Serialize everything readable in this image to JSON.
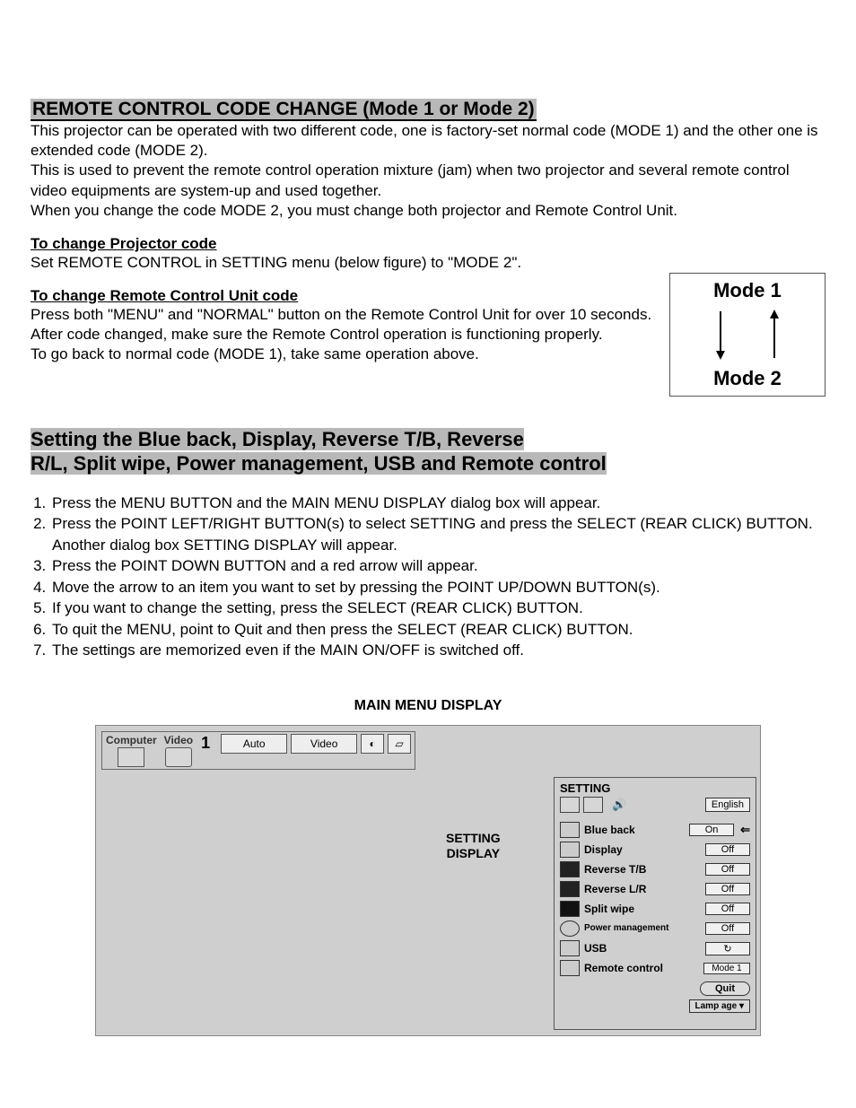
{
  "section1": {
    "title": "REMOTE CONTROL CODE CHANGE (Mode 1 or Mode 2)",
    "p1": "This projector can be operated with two different code, one is factory-set normal code (MODE 1) and the other one is extended code (MODE 2).",
    "p2": "This is used to prevent the remote control operation mixture (jam) when two projector and several remote control video equipments are system-up and used together.",
    "p3": "When you change the code MODE 2, you must change both projector and Remote Control Unit.",
    "sub1_title": "To change Projector code",
    "sub1_body": "Set REMOTE CONTROL in SETTING menu (below figure) to \"MODE 2\".",
    "sub2_title": "To change Remote Control Unit code",
    "sub2_body1": "Press both \"MENU\" and \"NORMAL\" button on the Remote Control Unit for over 10 seconds.",
    "sub2_body2": "After code changed, make sure the Remote Control operation is functioning properly.",
    "sub2_body3": "To go back to normal code (MODE 1), take same operation above."
  },
  "mode_box": {
    "top": "Mode 1",
    "bottom": "Mode 2"
  },
  "section2": {
    "title_l1": "Setting the Blue back, Display, Reverse T/B, Reverse",
    "title_l2": "R/L, Split wipe, Power management, USB and Remote control",
    "steps": [
      "Press the MENU BUTTON and the MAIN MENU DISPLAY dialog box will appear.",
      "Press the POINT LEFT/RIGHT BUTTON(s) to select SETTING and press the SELECT (REAR CLICK) BUTTON. Another dialog box SETTING DISPLAY will appear.",
      "Press the POINT DOWN BUTTON and a red arrow will appear.",
      "Move the arrow to an item you want to set by pressing the POINT UP/DOWN BUTTON(s).",
      "If you want to change the setting, press the SELECT (REAR CLICK) BUTTON.",
      "To quit the MENU, point to Quit and then press the SELECT (REAR CLICK) BUTTON.",
      "The settings are memorized even if the MAIN ON/OFF is switched off."
    ]
  },
  "menu": {
    "caption": "MAIN MENU DISPLAY",
    "top_tabs": {
      "computer": "Computer",
      "video": "Video",
      "one": "1",
      "auto": "Auto",
      "video2": "Video"
    },
    "setting_display_label_l1": "SETTING",
    "setting_display_label_l2": "DISPLAY",
    "setting_panel": {
      "title": "SETTING",
      "language": "English",
      "rows": [
        {
          "label": "Blue back",
          "value": "On",
          "arrow": true
        },
        {
          "label": "Display",
          "value": "Off"
        },
        {
          "label": "Reverse T/B",
          "value": "Off"
        },
        {
          "label": "Reverse L/R",
          "value": "Off"
        },
        {
          "label": "Split wipe",
          "value": "Off"
        },
        {
          "label": "Power management",
          "value": "Off"
        },
        {
          "label": "USB",
          "value": "↻"
        },
        {
          "label": "Remote control",
          "value": "Mode 1"
        }
      ],
      "quit": "Quit",
      "lamp": "Lamp age ▾"
    }
  }
}
